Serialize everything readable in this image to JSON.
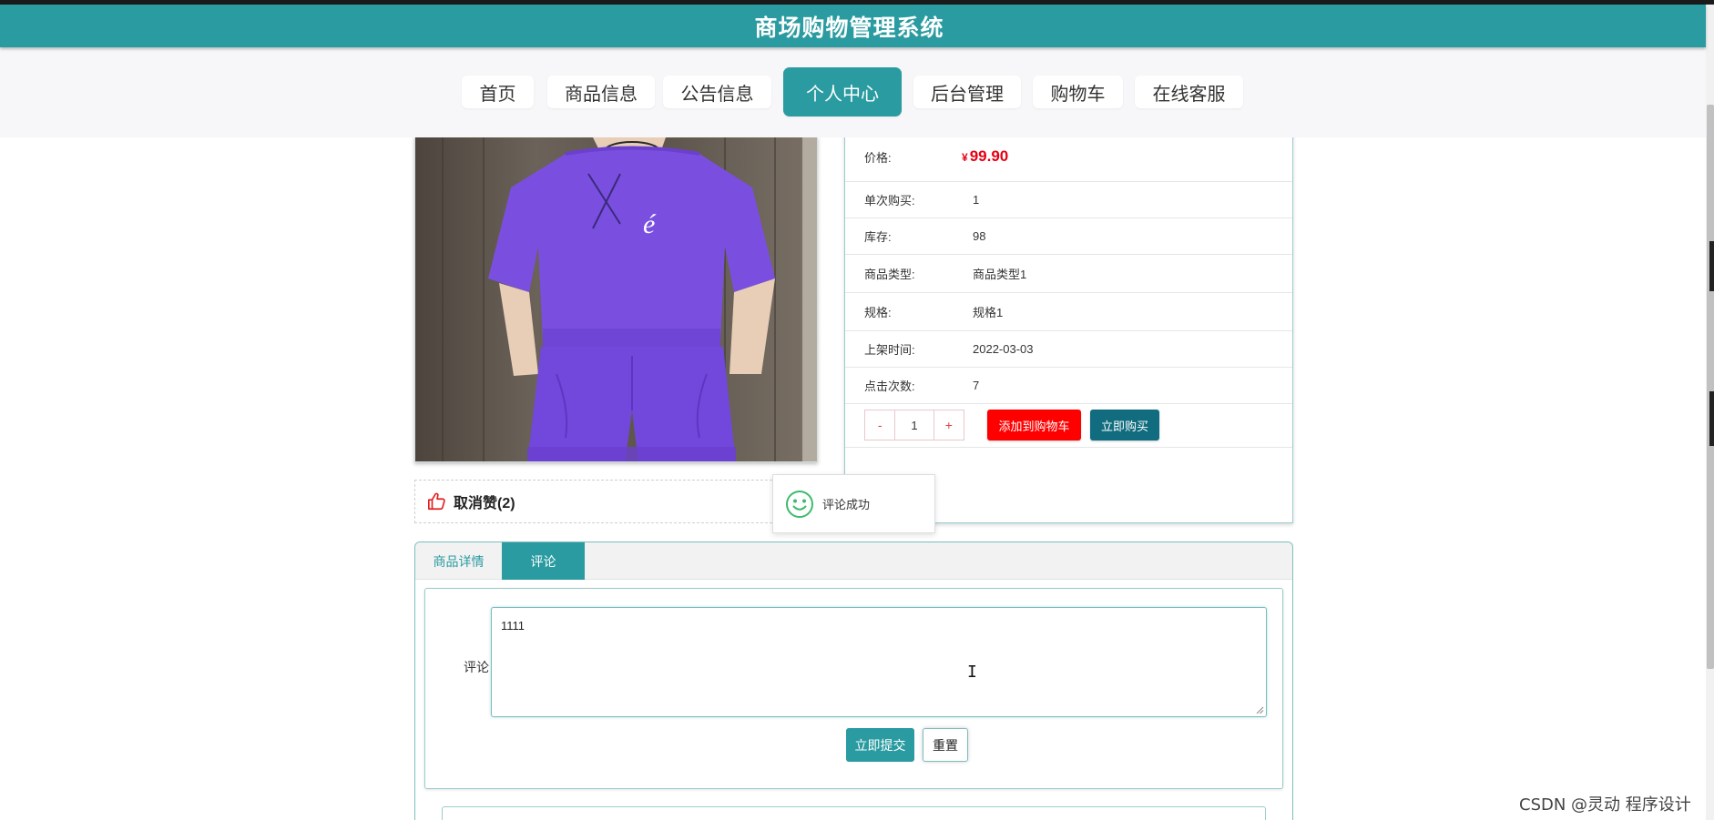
{
  "header": {
    "title": "商场购物管理系统"
  },
  "nav": {
    "items": [
      {
        "label": "首页"
      },
      {
        "label": "商品信息"
      },
      {
        "label": "公告信息"
      },
      {
        "label": "个人中心",
        "active": true
      },
      {
        "label": "后台管理"
      },
      {
        "label": "购物车"
      },
      {
        "label": "在线客服"
      }
    ]
  },
  "product": {
    "price_label": "价格:",
    "price_currency": "¥",
    "price_value": "99.90",
    "rows": [
      {
        "label": "单次购买:",
        "value": "1"
      },
      {
        "label": "库存:",
        "value": "98"
      },
      {
        "label": "商品类型:",
        "value": "商品类型1"
      },
      {
        "label": "规格:",
        "value": "规格1"
      },
      {
        "label": "上架时间:",
        "value": "2022-03-03"
      },
      {
        "label": "点击次数:",
        "value": "7"
      }
    ],
    "quantity": {
      "minus": "-",
      "value": "1",
      "plus": "+"
    },
    "add_to_cart_label": "添加到购物车",
    "buy_now_label": "立即购买"
  },
  "like": {
    "text": "取消赞(2)"
  },
  "toast": {
    "message": "评论成功",
    "icon": "smile-icon"
  },
  "tabs": [
    {
      "label": "商品详情"
    },
    {
      "label": "评论",
      "active": true
    }
  ],
  "comment_form": {
    "label": "评论",
    "value": "1111",
    "submit_label": "立即提交",
    "reset_label": "重置"
  },
  "watermark": "CSDN @灵动 程序设计",
  "colors": {
    "primary": "#2a9ba0",
    "price": "#e60012",
    "cart_button": "#ff0000",
    "buy_button": "#106c7e"
  }
}
